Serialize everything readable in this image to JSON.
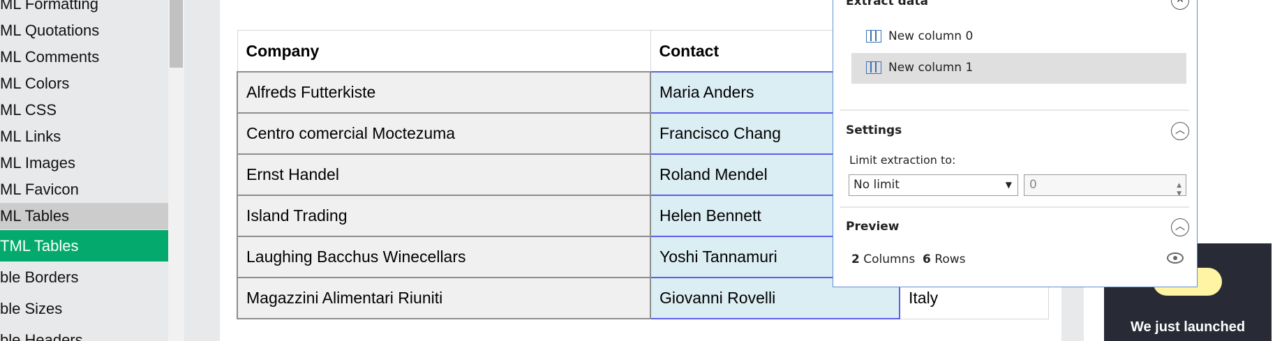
{
  "sidebar": {
    "items": [
      {
        "label": "ML Formatting"
      },
      {
        "label": "ML Quotations"
      },
      {
        "label": "ML Comments"
      },
      {
        "label": "ML Colors"
      },
      {
        "label": "ML CSS"
      },
      {
        "label": "ML Links"
      },
      {
        "label": "ML Images"
      },
      {
        "label": "ML Favicon"
      },
      {
        "label": "ML Tables"
      },
      {
        "label": "TML Tables"
      },
      {
        "label": "ble Borders"
      },
      {
        "label": "ble Sizes"
      },
      {
        "label": "ble Headers"
      }
    ],
    "active_color": "#04aa6d"
  },
  "table": {
    "headers": [
      "Company",
      "Contact",
      ""
    ],
    "rows": [
      [
        "Alfreds Futterkiste",
        "Maria Anders",
        ""
      ],
      [
        "Centro comercial Moctezuma",
        "Francisco Chang",
        ""
      ],
      [
        "Ernst Handel",
        "Roland Mendel",
        ""
      ],
      [
        "Island Trading",
        "Helen Bennett",
        ""
      ],
      [
        "Laughing Bacchus Winecellars",
        "Yoshi Tannamuri",
        ""
      ],
      [
        "Magazzini Alimentari Riuniti",
        "Giovanni Rovelli",
        "Italy"
      ]
    ]
  },
  "popup": {
    "title": "Extract data",
    "columns": [
      {
        "label": "New column 0",
        "icon": "table-column-icon"
      },
      {
        "label": "New column 1",
        "icon": "table-column-icon"
      }
    ],
    "settings": {
      "title": "Settings",
      "limit_label": "Limit extraction to:",
      "limit_value": "No limit",
      "limit_number": "0"
    },
    "preview": {
      "title": "Preview",
      "columns_count": "2",
      "columns_word": "Columns",
      "rows_count": "6",
      "rows_word": "Rows"
    }
  },
  "promo": {
    "text": "We just launched"
  }
}
